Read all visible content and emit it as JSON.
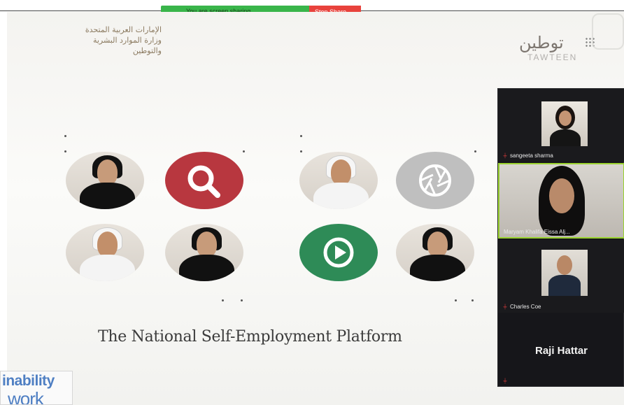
{
  "topbar": {
    "share_text": "You are screen sharing",
    "stop_label": "Stop Share"
  },
  "slide": {
    "ministry_lines": [
      "الإمارات العربية المتحدة",
      "وزارة الموارد البشرية",
      "والتوطين"
    ],
    "logo_arabic": "توطين",
    "logo_english": "TAWTEEN",
    "title": "The National Self-Employment Platform",
    "sustainability_line1": "inability",
    "sustainability_line2": "work"
  },
  "icons": {
    "search": "search-icon",
    "aperture": "aperture-icon",
    "play": "play-icon"
  },
  "colors": {
    "search_red": "#b8373f",
    "play_green": "#2e8b57",
    "aperture_gray": "#bfbfbf",
    "active_speaker": "#9ad22f",
    "mute_red": "#e23c3c"
  },
  "participants": [
    {
      "name": "sangeeta sharma",
      "muted": true
    },
    {
      "name": "Maryam Khalifa Eissa Alj...",
      "muted": false,
      "active": true
    },
    {
      "name": "Charles Coe",
      "muted": true
    },
    {
      "name": "Raji Hattar",
      "muted": true
    }
  ]
}
